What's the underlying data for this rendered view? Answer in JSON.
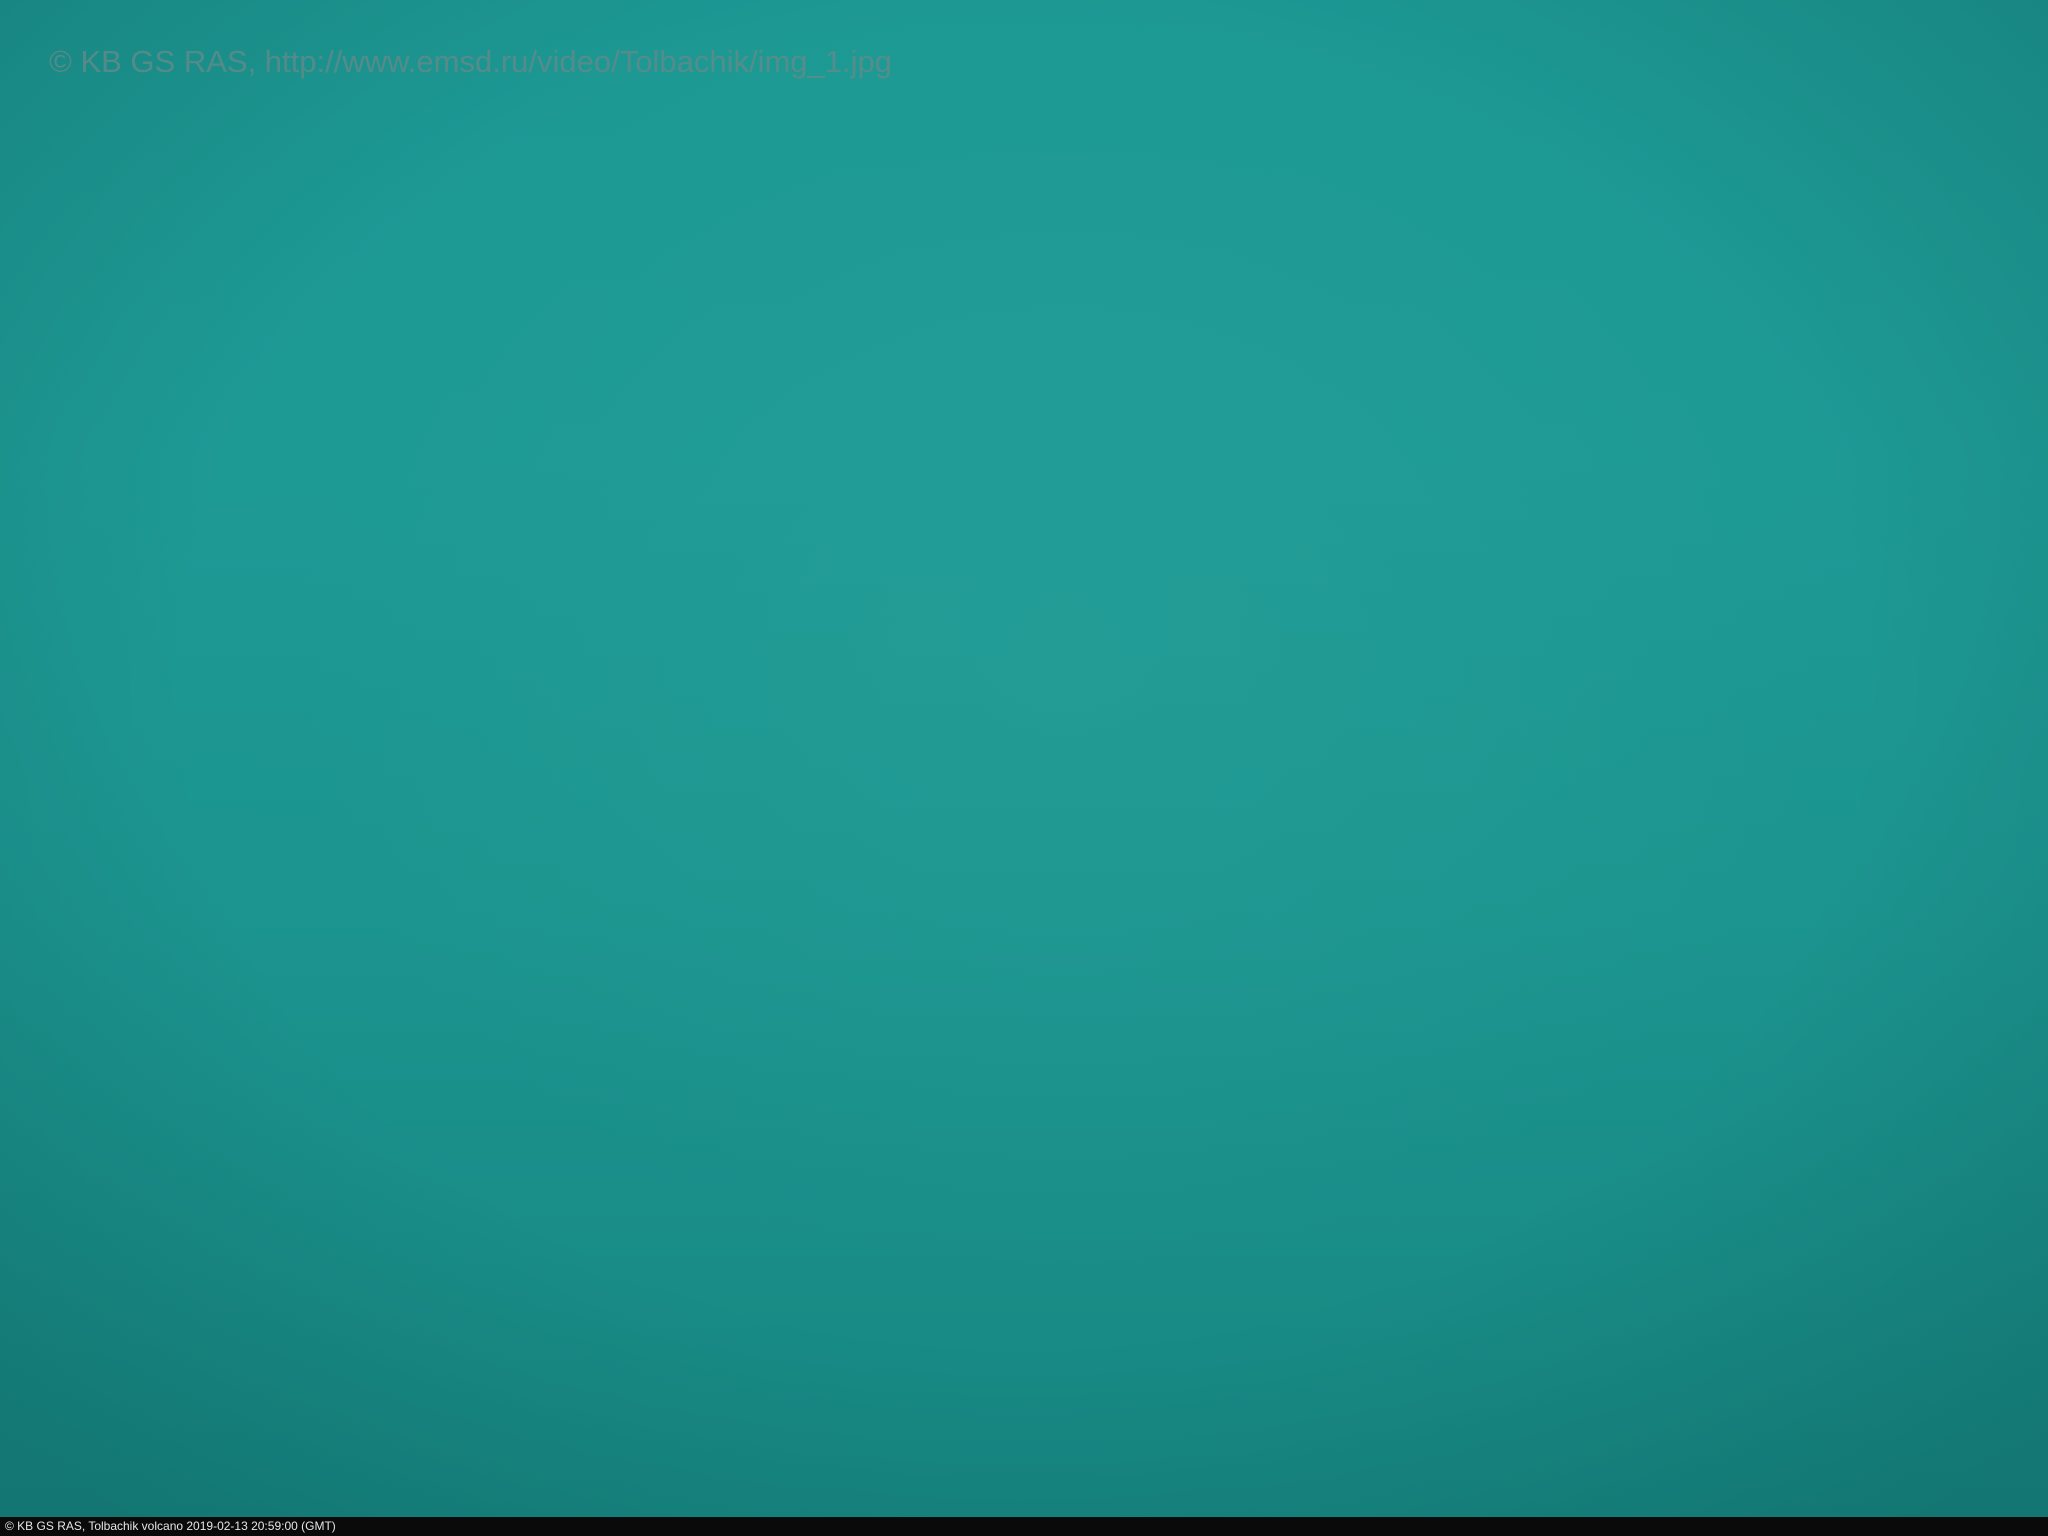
{
  "watermark": {
    "text": "© KB GS RAS, http://www.emsd.ru/video/Tolbachik/img_1.jpg"
  },
  "caption": {
    "text": "© KB GS RAS, Tolbachik volcano 2019-02-13 20:59:00 (GMT)"
  },
  "colors": {
    "sky": "#1d9994",
    "caption_bar": "#0a0a0a",
    "watermark_text": "#5f8b8a",
    "caption_text": "#e6e6e6"
  }
}
